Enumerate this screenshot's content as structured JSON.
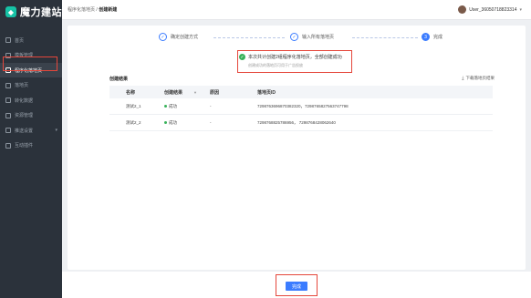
{
  "brand": {
    "name": "魔力建站",
    "mark": "◆"
  },
  "sidebar": {
    "items": [
      {
        "label": "首页",
        "icon": "home-icon"
      },
      {
        "label": "模板管理",
        "icon": "template-icon"
      },
      {
        "label": "程序化落地页",
        "icon": "program-page-icon"
      },
      {
        "label": "落地页",
        "icon": "landing-icon"
      },
      {
        "label": "转化数据",
        "icon": "data-icon"
      },
      {
        "label": "资源管理",
        "icon": "resource-icon"
      },
      {
        "label": "推送设置",
        "icon": "push-icon"
      },
      {
        "label": "互动插件",
        "icon": "plugin-icon"
      }
    ]
  },
  "header": {
    "breadcrumb_parent": "程序化落地页",
    "breadcrumb_sep": " / ",
    "breadcrumb_current": "创建新建",
    "user": "User_36050718823314"
  },
  "steps": [
    {
      "num": "✓",
      "label": "确定创建方式"
    },
    {
      "num": "✓",
      "label": "输入所有落地页"
    },
    {
      "num": "3",
      "label": "完成"
    }
  ],
  "success": {
    "title": "本次共计创建2组程序化落地页，全部创建成功",
    "subtitle": "创建成功的落地页可用于广告投放"
  },
  "results": {
    "title": "创建结果",
    "download": "下载落地页结果",
    "columns": [
      "名称",
      "创建结果",
      "原因",
      "落地页ID"
    ],
    "rows": [
      {
        "name": "测试2_1",
        "result": "成功",
        "reason": "-",
        "ids": "7298763696870382320，7298765827563747798"
      },
      {
        "name": "测试2_2",
        "result": "成功",
        "reason": "-",
        "ids": "7298768825786956， 7298768428062640"
      }
    ]
  },
  "footer": {
    "done_label": "完成"
  }
}
